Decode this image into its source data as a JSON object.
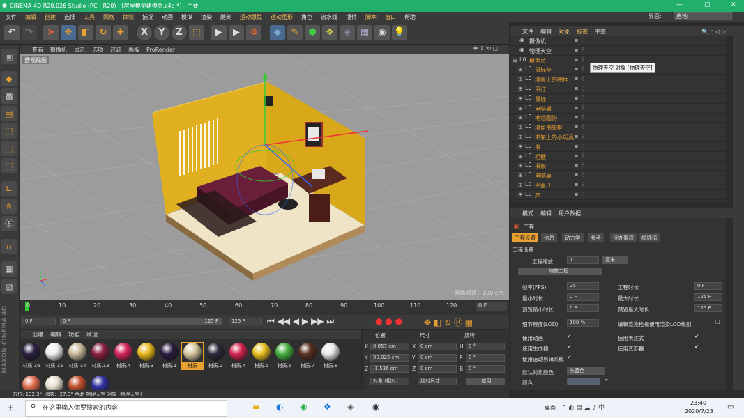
{
  "window": {
    "title": "CINEMA 4D R20.026 Studio (RC - R20) - [房屋模型建模总.c4d *] - 主要",
    "min": "—",
    "max": "▢",
    "close": "✕"
  },
  "menu": [
    "文件",
    "编辑",
    "创建",
    "选择",
    "工具",
    "网格",
    "体积",
    "捕捉",
    "动画",
    "模拟",
    "渲染",
    "雕刻",
    "运动跟踪",
    "运动图形",
    "角色",
    "流水线",
    "插件",
    "脚本",
    "窗口",
    "帮助"
  ],
  "layout": {
    "label": "界面:",
    "value": "启动"
  },
  "viewport": {
    "menu": [
      "查看",
      "摄像机",
      "显示",
      "选项",
      "过滤",
      "面板",
      "ProRender"
    ],
    "label": "透视视图",
    "grid_info": "网格间距：100 cm"
  },
  "timeline": {
    "ticks": [
      "0",
      "10",
      "20",
      "30",
      "40",
      "50",
      "60",
      "70",
      "80",
      "90",
      "100",
      "110",
      "120"
    ],
    "end": "0 F"
  },
  "transport": {
    "start": "0 F",
    "range_start": "0 F",
    "range_end": "125 F",
    "end": "125 F"
  },
  "materials": {
    "menu": [
      "创建",
      "编辑",
      "功能",
      "纹理"
    ],
    "items": [
      {
        "label": "材质.16",
        "color": "#2a2040"
      },
      {
        "label": "材质.15",
        "color": "#eeeeee"
      },
      {
        "label": "材质.14",
        "color": "#c9b89a"
      },
      {
        "label": "材质.13",
        "color": "#8a2040"
      },
      {
        "label": "材质.4",
        "color": "#d6245a"
      },
      {
        "label": "材质.3",
        "color": "#e8b81c"
      },
      {
        "label": "材质.1",
        "color": "#2a1e40"
      },
      {
        "label": "材质",
        "color": "#d8c8a0"
      },
      {
        "label": "材质.2",
        "color": "#2a2a3a"
      },
      {
        "label": "材质.4",
        "color": "#d62450"
      },
      {
        "label": "材质.5",
        "color": "#e8c020"
      },
      {
        "label": "材质.6",
        "color": "#46b040"
      },
      {
        "label": "材质.7",
        "color": "#5a3020"
      },
      {
        "label": "材质.8",
        "color": "#e8e8e8"
      }
    ],
    "row2": [
      "#e07050",
      "#e8e0d0",
      "#c05030",
      "#3030a0"
    ]
  },
  "coords": {
    "headers": [
      "位置",
      "尺寸",
      "旋转"
    ],
    "rows": [
      {
        "axis": "X",
        "pos": "0.857 cm",
        "size_axis": "X",
        "size": "0 cm",
        "rot_axis": "H",
        "rot": "0 °"
      },
      {
        "axis": "Y",
        "pos": "90.025 cm",
        "size_axis": "Y",
        "size": "0 cm",
        "rot_axis": "P",
        "rot": "0 °"
      },
      {
        "axis": "Z",
        "pos": "-1.536 cm",
        "size_axis": "Z",
        "size": "0 cm",
        "rot_axis": "B",
        "rot": "0 °"
      }
    ],
    "mode": "对象 (相对)",
    "sizemode": "绝对尺寸",
    "apply": "应用"
  },
  "status": "方位: 132.3°, 海拔: -27.3° 西北   物理天空 对象 [物理天空]",
  "objects": {
    "menu": [
      "文件",
      "编辑",
      "对象",
      "标签",
      "书签"
    ],
    "rows": [
      {
        "name": "摄像机",
        "color": "#dddddd",
        "indent": 0
      },
      {
        "name": "物理天空",
        "color": "#dddddd",
        "indent": 0
      },
      {
        "name": "模型总",
        "color": "#e8a030",
        "indent": 0
      },
      {
        "name": "鼠标垫",
        "color": "#e8a030",
        "indent": 1
      },
      {
        "name": "墙面上的相框",
        "color": "#e8a030",
        "indent": 1
      },
      {
        "name": "吊灯",
        "color": "#e8a030",
        "indent": 1
      },
      {
        "name": "鼠标",
        "color": "#e8a030",
        "indent": 1
      },
      {
        "name": "电脑桌",
        "color": "#e8a030",
        "indent": 1
      },
      {
        "name": "地毯圆钩",
        "color": "#e8a030",
        "indent": 1
      },
      {
        "name": "墙角书架柜",
        "color": "#e8a030",
        "indent": 1
      },
      {
        "name": "书架上的小玩具",
        "color": "#e8a030",
        "indent": 1
      },
      {
        "name": "书",
        "color": "#e8a030",
        "indent": 1
      },
      {
        "name": "相框",
        "color": "#e8a030",
        "indent": 1
      },
      {
        "name": "书架",
        "color": "#e8a030",
        "indent": 1
      },
      {
        "name": "电脑桌",
        "color": "#e8a030",
        "indent": 1
      },
      {
        "name": "平面.1",
        "color": "#e8a030",
        "indent": 1
      },
      {
        "name": "床",
        "color": "#e8a030",
        "indent": 1
      }
    ],
    "tooltip": "物理天空 对象 [物理天空]"
  },
  "attributes": {
    "menu": [
      "模式",
      "编辑",
      "用户数据"
    ],
    "title": "工程",
    "tabs": [
      "工程设置",
      "信息",
      "动力学",
      "参考",
      "待办事项",
      "帧插值"
    ],
    "section": "工程设置",
    "scale_label": "工程缩放",
    "scale_value": "1",
    "scale_unit": "厘米",
    "scale_button": "缩放工程...",
    "fps_label": "帧率(FPS)",
    "fps": "25",
    "time_label": "工程时长",
    "time": "0 F",
    "min_label": "最小时长",
    "min": "0 F",
    "max_label": "最大时长",
    "max": "125 F",
    "pmin_label": "预览最小时长",
    "pmin": "0 F",
    "pmax_label": "预览最大时长",
    "pmax": "125 F",
    "lod_label": "细节程度(LOD)",
    "lod": "100 %",
    "lod_edit": "编辑渲染检视使用渲染LOD级别",
    "anim": "使用动画",
    "expr": "使用表达式",
    "gen": "使用生成器",
    "deform": "使用变形器",
    "motion": "使用运动剪辑系统",
    "defcolor_label": "默认对象颜色",
    "defcolor": "灰蓝色",
    "color_label": "颜色"
  },
  "taskbar": {
    "search": "在这里输入你要搜索的内容",
    "desktop": "桌面",
    "time": "23:40",
    "date": "2020/7/23"
  }
}
